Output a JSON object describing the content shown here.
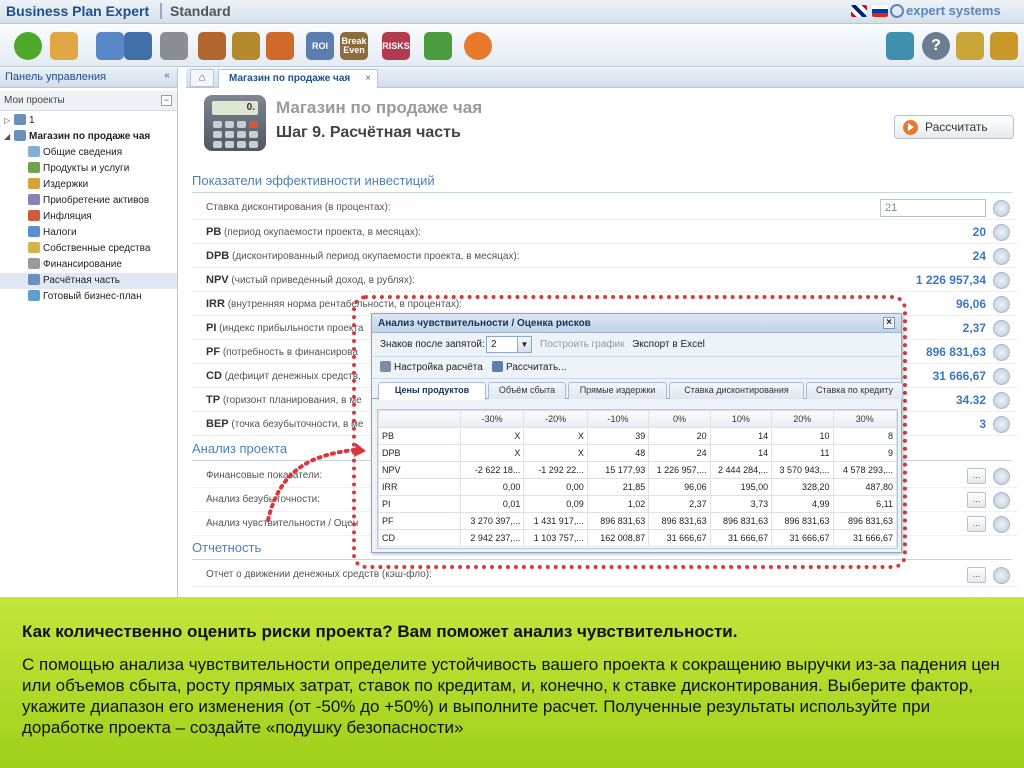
{
  "titlebar": {
    "app_name": "Business Plan Expert",
    "edition": "Standard",
    "brand": "expert systems"
  },
  "toolbar": {
    "buttons": [
      {
        "icon": "add-icon",
        "color": "#4ea82a"
      },
      {
        "icon": "open-project-icon",
        "color": "#e0a845"
      },
      {
        "icon": "copy-icon",
        "color": "#5a87c8"
      },
      {
        "icon": "save-icon",
        "color": "#3f6ea8"
      },
      {
        "icon": "delete-icon",
        "color": "#8a8f96"
      },
      {
        "icon": "compass-icon",
        "color": "#b0662e"
      },
      {
        "icon": "money-bag-icon",
        "color": "#b58a2e"
      },
      {
        "icon": "arrows-icon",
        "color": "#d06a2a"
      },
      {
        "icon": "roi-icon",
        "label": "ROI",
        "color": "#5a7fae"
      },
      {
        "icon": "break-even-icon",
        "label": "Break Even",
        "color": "#8d6b3a"
      },
      {
        "icon": "risks-icon",
        "label": "RISKS",
        "color": "#b23a4f"
      },
      {
        "icon": "puzzle-icon",
        "color": "#4a9c3e"
      },
      {
        "icon": "play-icon",
        "color": "#e8792a"
      },
      {
        "icon": "user-tools-icon",
        "color": "#3f8fae"
      },
      {
        "icon": "help-icon",
        "label": "?",
        "color": "#6c7d92"
      },
      {
        "icon": "edit-icon",
        "color": "#c9a53a"
      },
      {
        "icon": "exit-icon",
        "color": "#c99a2a"
      }
    ]
  },
  "left_panel": {
    "title": "Панель управления",
    "collapse": "«",
    "projects_label": "Мои проекты",
    "minus": "−",
    "tree": [
      {
        "label": "1",
        "level": 0,
        "toggle": "▷",
        "color": "#6b8fbf"
      },
      {
        "label": "Магазин по продаже чая",
        "level": 0,
        "toggle": "◢",
        "color": "#6b8fbf",
        "bold": true
      },
      {
        "label": "Общие сведения",
        "level": 1,
        "color": "#7fb0d8"
      },
      {
        "label": "Продукты и услуги",
        "level": 1,
        "color": "#6fa14f"
      },
      {
        "label": "Издержки",
        "level": 1,
        "color": "#d9a13a"
      },
      {
        "label": "Приобретение активов",
        "level": 1,
        "color": "#8e7fb8"
      },
      {
        "label": "Инфляция",
        "level": 1,
        "color": "#d05a3a"
      },
      {
        "label": "Налоги",
        "level": 1,
        "color": "#5d8fd0"
      },
      {
        "label": "Собственные средства",
        "level": 1,
        "color": "#d7b24b"
      },
      {
        "label": "Финансирование",
        "level": 1,
        "color": "#9a9a9a"
      },
      {
        "label": "Расчётная часть",
        "level": 1,
        "color": "#6b8fbf",
        "selected": true
      },
      {
        "label": "Готовый бизнес-план",
        "level": 1,
        "color": "#5f9fd0"
      }
    ]
  },
  "tabs": {
    "home": "⌂",
    "page_tab": "Магазин по продаже чая",
    "close": "×"
  },
  "main": {
    "calc_screen": "0.",
    "project_title": "Магазин по продаже чая",
    "step_title": "Шаг 9. Расчётная часть",
    "calculate_button": "Рассчитать",
    "section_efficiency": "Показатели эффективности инвестиций",
    "discount_rate": {
      "label": "Ставка дисконтирования (в процентах):",
      "value": "21"
    },
    "metrics": [
      {
        "code": "PB",
        "label": " (период окупаемости проекта, в месяцах):",
        "value": "20"
      },
      {
        "code": "DPB",
        "label": " (дисконтированный период окупаемости проекта, в месяцах):",
        "value": "24"
      },
      {
        "code": "NPV",
        "label": " (чистый приведенный доход, в рублях):",
        "value": "1 226 957,34"
      },
      {
        "code": "IRR",
        "label": " (внутренняя норма рентабельности, в процентах):",
        "value": "96,06"
      },
      {
        "code": "PI",
        "label": " (индекс прибыльности проекта",
        "value": "2,37"
      },
      {
        "code": "PF",
        "label": " (потребность в финансирова",
        "value": "896 831,63"
      },
      {
        "code": "CD",
        "label": " (дефицит денежных средств,",
        "value": "31 666,67"
      },
      {
        "code": "TP",
        "label": " (горизонт планирования, в ме",
        "value": "34.32"
      },
      {
        "code": "BEP",
        "label": " (точка безубыточности, в ме",
        "value": "3"
      }
    ],
    "section_analysis": "Анализ проекта",
    "analysis_rows": [
      {
        "label": "Финансовые показатели:"
      },
      {
        "label": "Анализ безубыточности:"
      },
      {
        "label": "Анализ чувствительности / Оцен"
      }
    ],
    "section_reports": "Отчетность",
    "report_rows": [
      {
        "label": "Отчет о движении денежных средств (кэш-фло):"
      }
    ],
    "more_label": "..."
  },
  "dialog": {
    "title": "Анализ чувствительности / Оценка рисков",
    "close": "×",
    "decimals_label": "Знаков после запятой:",
    "decimals_value": "2",
    "build_chart": "Построить график",
    "export_excel": "Экспорт в Excel",
    "calc_settings": "Настройка расчёта",
    "calculate": "Рассчитать...",
    "tabs": [
      "Цены продуктов",
      "Объём сбыта",
      "Прямые издержки",
      "Ставка дисконтирования",
      "Ставка по кредиту"
    ],
    "active_tab": 0,
    "columns": [
      "",
      "-30%",
      "-20%",
      "-10%",
      "0%",
      "10%",
      "20%",
      "30%"
    ],
    "rows": [
      [
        "PB",
        "X",
        "X",
        "39",
        "20",
        "14",
        "10",
        "8"
      ],
      [
        "DPB",
        "X",
        "X",
        "48",
        "24",
        "14",
        "11",
        "9"
      ],
      [
        "NPV",
        "-2 622 18...",
        "-1 292 22...",
        "15 177,93",
        "1 226 957,...",
        "2 444 284,...",
        "3 570 943,...",
        "4 578 293,..."
      ],
      [
        "IRR",
        "0,00",
        "0,00",
        "21,85",
        "96,06",
        "195,00",
        "328,20",
        "487,80"
      ],
      [
        "PI",
        "0,01",
        "0,09",
        "1,02",
        "2,37",
        "3,73",
        "4,99",
        "6,11"
      ],
      [
        "PF",
        "3 270 397,...",
        "1 431 917,...",
        "896 831,63",
        "896 831,63",
        "896 831,63",
        "896 831,63",
        "896 831,63"
      ],
      [
        "CD",
        "2 942 237,...",
        "1 103 757,...",
        "162 008,87",
        "31 666,67",
        "31 666,67",
        "31 666,67",
        "31 666,67"
      ]
    ]
  },
  "banner": {
    "heading": "Как количественно оценить риски проекта? Вам поможет анализ чувствительности.",
    "text": "С помощью анализа чувствительности определите устойчивость вашего проекта к сокращению выручки из-за падения цен или объемов сбыта, росту прямых затрат, ставок по кредитам, и, конечно, к ставке дисконтирования. Выберите фактор, укажите диапазон его изменения (от -50% до +50%) и выполните расчет. Полученные результаты используйте при доработке проекта – создайте «подушку безопасности»"
  },
  "colors": {
    "accent": "#4f80b7",
    "value_blue": "#3c78c2",
    "annotation_red": "#d9373b",
    "banner_green": "#b3dc2a"
  }
}
